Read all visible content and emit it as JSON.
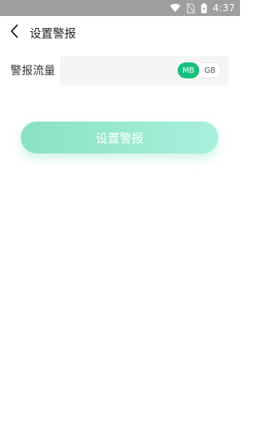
{
  "status_bar": {
    "time": "4:37",
    "icons": [
      "wifi-icon",
      "no-sim-icon",
      "battery-icon"
    ]
  },
  "nav": {
    "back_icon": "chevron-left-icon",
    "title": "设置警报"
  },
  "form": {
    "traffic_label": "警报流量",
    "traffic_value": "",
    "units": [
      {
        "label": "MB",
        "selected": true
      },
      {
        "label": "GB",
        "selected": false
      }
    ]
  },
  "submit_button": {
    "label": "设置警报"
  },
  "colors": {
    "status_bar": "#9e9e9e",
    "accent": "#19bf7c",
    "button_gradient_start": "#89e2c2",
    "button_gradient_end": "#a9f0dd"
  }
}
